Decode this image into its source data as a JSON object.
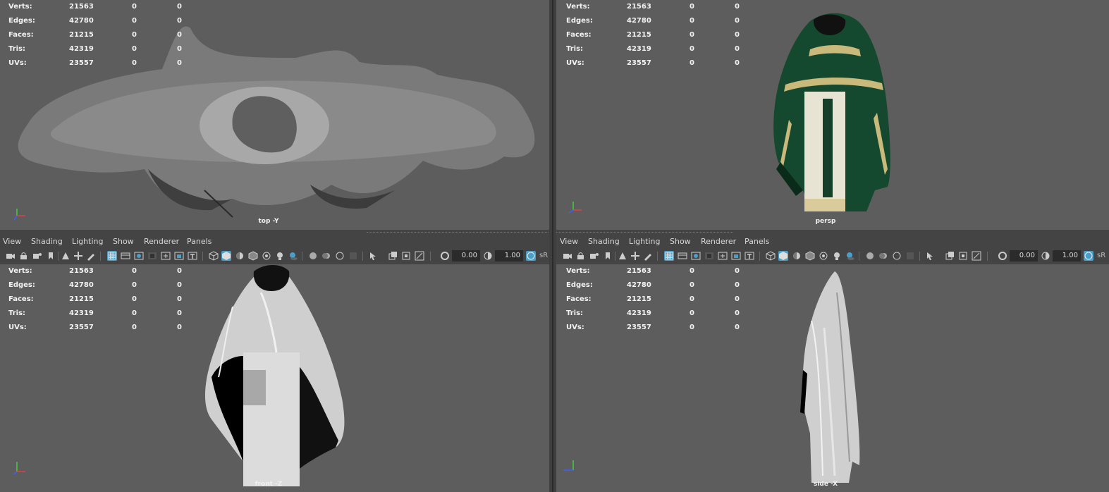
{
  "stats_rows": [
    {
      "label": "Verts:",
      "v1": "21563",
      "v2": "0",
      "v3": "0"
    },
    {
      "label": "Edges:",
      "v1": "42780",
      "v2": "0",
      "v3": "0"
    },
    {
      "label": "Faces:",
      "v1": "21215",
      "v2": "0",
      "v3": "0"
    },
    {
      "label": "Tris:",
      "v1": "42319",
      "v2": "0",
      "v3": "0"
    },
    {
      "label": "UVs:",
      "v1": "23557",
      "v2": "0",
      "v3": "0"
    }
  ],
  "viewports": {
    "top": {
      "label": "top -Y"
    },
    "persp": {
      "label": "persp"
    },
    "front": {
      "label": "front -Z"
    },
    "side": {
      "label": "side -X"
    }
  },
  "menu": [
    "View",
    "Shading",
    "Lighting",
    "Show",
    "Renderer",
    "Panels"
  ],
  "toolbar": {
    "exposure": "0.00",
    "gamma": "1.00",
    "colorspace": "sR"
  },
  "colors": {
    "viewport_bg": "#5d5d5d",
    "panel_bg": "#444444",
    "highlight": "#4a9fc8",
    "vestment_green": "#14492f",
    "vestment_gold": "#c9b97a",
    "axis_x": "#e04040",
    "axis_y": "#40d040",
    "axis_z": "#4060ff"
  },
  "icons": [
    "camera-icon",
    "lock-camera-icon",
    "bookmark-icon",
    "select-camera-icon",
    "grid-icon",
    "film-gate-icon",
    "resolution-gate-icon",
    "safe-action-icon",
    "field-chart-icon",
    "wireframe-icon",
    "smooth-shade-icon",
    "xray-icon",
    "textured-icon",
    "light-icon",
    "shadow-icon",
    "isolate-icon",
    "exposure-icon",
    "gamma-icon"
  ]
}
